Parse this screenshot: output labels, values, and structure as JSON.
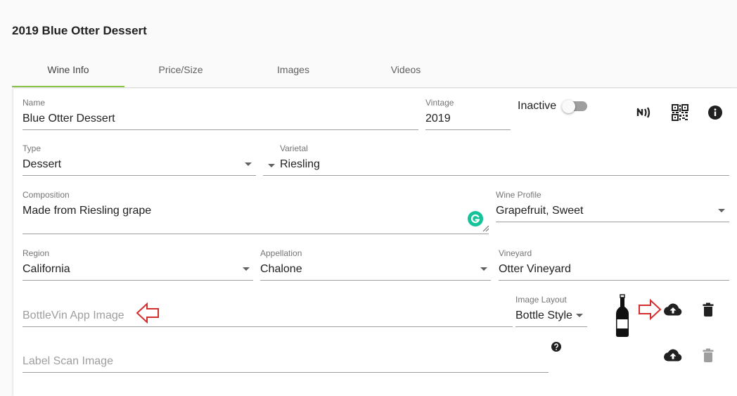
{
  "page": {
    "title": "2019 Blue Otter Dessert"
  },
  "tabs": [
    {
      "label": "Wine Info",
      "active": true
    },
    {
      "label": "Price/Size",
      "active": false
    },
    {
      "label": "Images",
      "active": false
    },
    {
      "label": "Videos",
      "active": false
    }
  ],
  "form": {
    "name": {
      "label": "Name",
      "value": "Blue Otter Dessert"
    },
    "vintage": {
      "label": "Vintage",
      "value": "2019"
    },
    "inactive": {
      "label": "Inactive",
      "checked": false
    },
    "type": {
      "label": "Type",
      "value": "Dessert"
    },
    "varietal": {
      "label": "Varietal",
      "value": "Riesling"
    },
    "composition": {
      "label": "Composition",
      "value": "Made from Riesling grape"
    },
    "wine_profile": {
      "label": "Wine Profile",
      "value": "Grapefruit, Sweet"
    },
    "region": {
      "label": "Region",
      "value": "California"
    },
    "appellation": {
      "label": "Appellation",
      "value": "Chalone"
    },
    "vineyard": {
      "label": "Vineyard",
      "value": "Otter Vineyard"
    },
    "bottlevin_image": {
      "placeholder": "BottleVin App Image"
    },
    "image_layout": {
      "label": "Image Layout",
      "value": "Bottle Style"
    },
    "label_scan_image": {
      "placeholder": "Label Scan Image"
    }
  },
  "icons": {
    "nfc": "nfc-icon",
    "qr": "qr-code-icon",
    "info": "info-icon",
    "grammarly": "grammarly-icon",
    "bottle": "wine-bottle-icon",
    "upload": "cloud-upload-icon",
    "delete": "delete-icon",
    "help": "help-icon",
    "arrow": "arrow-left-outline-icon"
  },
  "colors": {
    "accent": "#8bc34a",
    "annotation_arrow": "#d32f2f",
    "grammarly": "#15c39a"
  }
}
